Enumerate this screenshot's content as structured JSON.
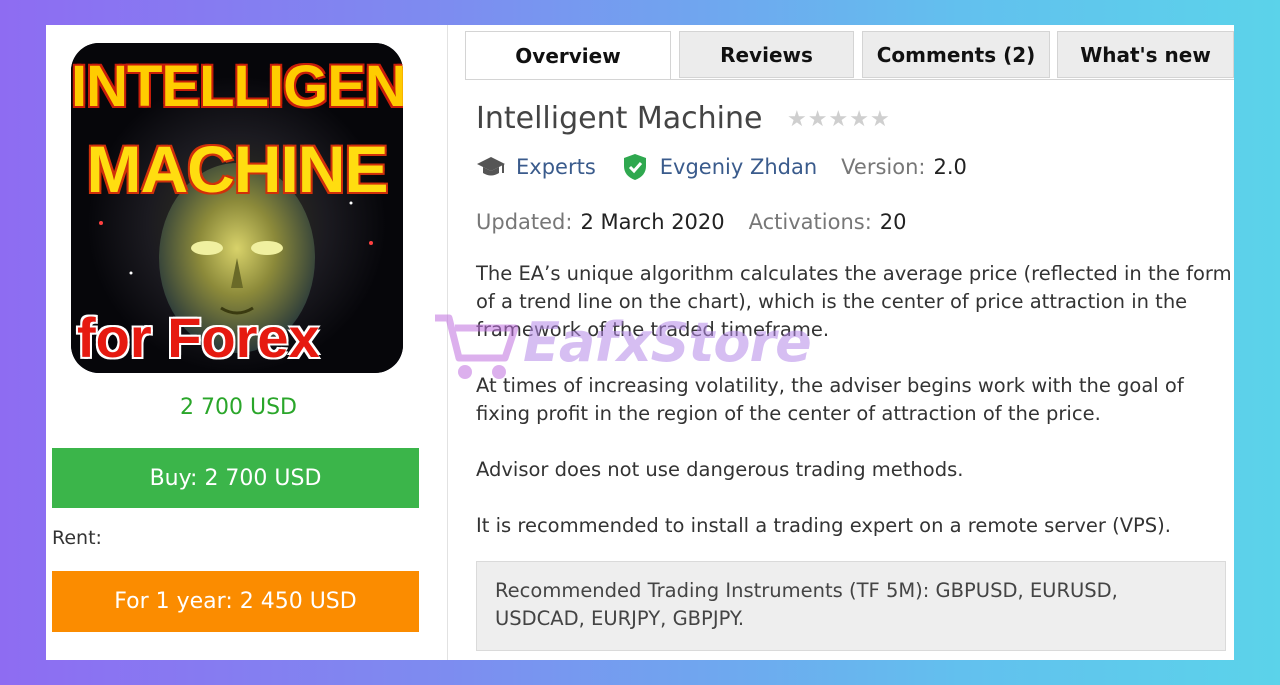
{
  "product": {
    "image_lines": [
      "INTELLIGENT",
      "MACHINE",
      "for Forex"
    ],
    "price": "2 700 USD",
    "buy_label": "Buy: 2 700 USD",
    "rent_label": "Rent:",
    "rent_option": "For 1 year: 2 450 USD"
  },
  "tabs": [
    {
      "label": "Overview",
      "active": true
    },
    {
      "label": "Reviews",
      "active": false
    },
    {
      "label": "Comments (2)",
      "active": false
    },
    {
      "label": "What's new",
      "active": false
    }
  ],
  "details": {
    "title": "Intelligent Machine",
    "rating_stars": 0,
    "rating_max": 5,
    "category": "Experts",
    "category_icon": "graduation-cap-icon",
    "author": "Evgeniy Zhdan",
    "author_icon": "verified-shield-icon",
    "version_label": "Version:",
    "version_value": "2.0",
    "updated_label": "Updated:",
    "updated_value": "2 March 2020",
    "activations_label": "Activations:",
    "activations_value": "20"
  },
  "description": [
    "The EA’s unique algorithm calculates the average price (reflected in the form of a trend line on the chart), which is the center of price attraction in the framework of the traded timeframe.",
    "At times of increasing volatility, the adviser begins work with the goal of fixing profit in the region of the center of attraction of the price.",
    "Advisor does not use dangerous trading methods.",
    "It is recommended to install a trading expert on a remote server (VPS)."
  ],
  "recommendation": "Recommended Trading Instruments (TF 5M): GBPUSD, EURUSD, USDCAD, EURJPY, GBPJPY.",
  "watermark": {
    "text": "EafxStore",
    "icon": "shopping-cart-icon"
  },
  "colors": {
    "buy": "#3bb54a",
    "rent": "#fb8c00",
    "price": "#2aa62a",
    "link": "#3a5b8c"
  }
}
